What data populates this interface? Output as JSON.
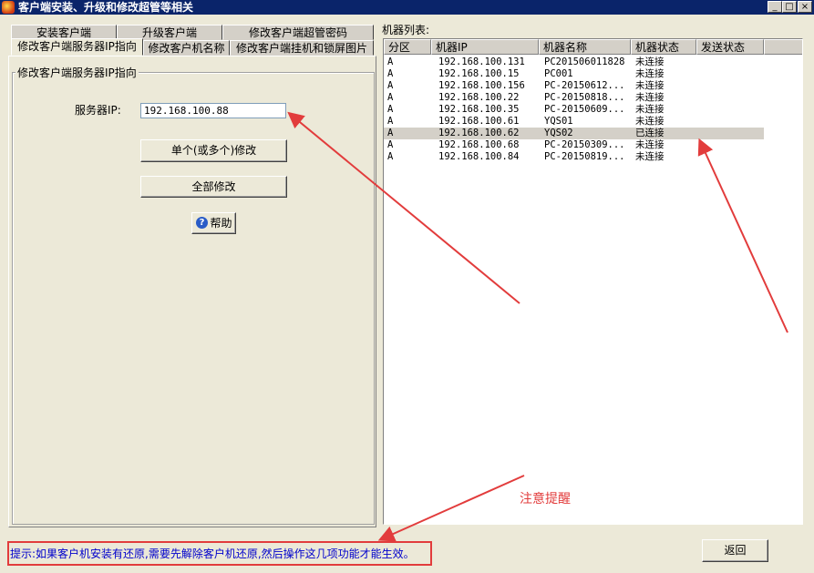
{
  "window": {
    "title": "客户端安装、升级和修改超管等相关",
    "controls": [
      "_",
      "□",
      "×"
    ]
  },
  "tabs_row1": [
    "安装客户端",
    "升级客户端",
    "修改客户端超管密码"
  ],
  "tabs_row2": [
    "修改客户端服务器IP指向",
    "修改客户机名称",
    "修改客户端挂机和锁屏图片"
  ],
  "left_panel": {
    "group_title": "修改客户端服务器IP指向",
    "server_ip_label": "服务器IP:",
    "server_ip_value": "192.168.100.88",
    "btn_single": "单个(或多个)修改",
    "btn_all": "全部修改",
    "btn_help": "帮助"
  },
  "machine_list": {
    "label": "机器列表:",
    "columns": [
      "分区",
      "机器IP",
      "机器名称",
      "机器状态",
      "发送状态"
    ],
    "rows": [
      {
        "zone": "A",
        "ip": "192.168.100.131",
        "name": "PC201506011828",
        "state": "未连接",
        "send": ""
      },
      {
        "zone": "A",
        "ip": "192.168.100.15",
        "name": "PC001",
        "state": "未连接",
        "send": ""
      },
      {
        "zone": "A",
        "ip": "192.168.100.156",
        "name": "PC-20150612...",
        "state": "未连接",
        "send": ""
      },
      {
        "zone": "A",
        "ip": "192.168.100.22",
        "name": "PC-20150818...",
        "state": "未连接",
        "send": ""
      },
      {
        "zone": "A",
        "ip": "192.168.100.35",
        "name": "PC-20150609...",
        "state": "未连接",
        "send": ""
      },
      {
        "zone": "A",
        "ip": "192.168.100.61",
        "name": "YQS01",
        "state": "未连接",
        "send": ""
      },
      {
        "zone": "A",
        "ip": "192.168.100.62",
        "name": "YQS02",
        "state": "已连接",
        "send": "",
        "selected": true
      },
      {
        "zone": "A",
        "ip": "192.168.100.68",
        "name": "PC-20150309...",
        "state": "未连接",
        "send": ""
      },
      {
        "zone": "A",
        "ip": "192.168.100.84",
        "name": "PC-20150819...",
        "state": "未连接",
        "send": ""
      }
    ]
  },
  "footer": {
    "hint": "提示:如果客户机安装有还原,需要先解除客户机还原,然后操作这几项功能才能生效。",
    "btn_back": "返回"
  },
  "annotation": {
    "label": "注意提醒",
    "color": "#e23c3c"
  }
}
